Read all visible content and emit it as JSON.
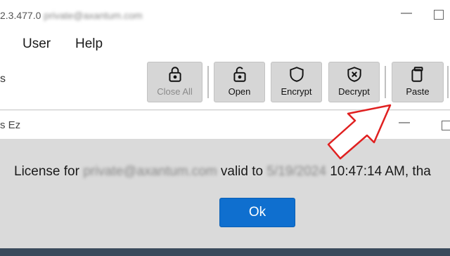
{
  "window": {
    "version": "2.3.477.0",
    "email_blurred": "private@axantum.com"
  },
  "menu": {
    "user": "User",
    "help": "Help"
  },
  "toolbar": {
    "left_fragment": "s",
    "buttons": [
      {
        "label": "Close All",
        "icon": "lock-icon",
        "enabled": false
      },
      {
        "label": "Open",
        "icon": "unlock-icon",
        "enabled": true
      },
      {
        "label": "Encrypt",
        "icon": "shield-icon",
        "enabled": true
      },
      {
        "label": "Decrypt",
        "icon": "shield-x-icon",
        "enabled": true
      },
      {
        "label": "Paste",
        "icon": "clipboard-icon",
        "enabled": true
      }
    ]
  },
  "dialog": {
    "title": "s Ez",
    "message_prefix": "License for",
    "message_email_blurred": "private@axantum.com",
    "message_mid": "valid to",
    "message_date_blurred": "5/19/2024",
    "message_suffix": "10:47:14 AM, tha",
    "ok_label": "Ok"
  },
  "colors": {
    "ok_button": "#0f6fcf",
    "annotation_arrow": "#e02020"
  }
}
